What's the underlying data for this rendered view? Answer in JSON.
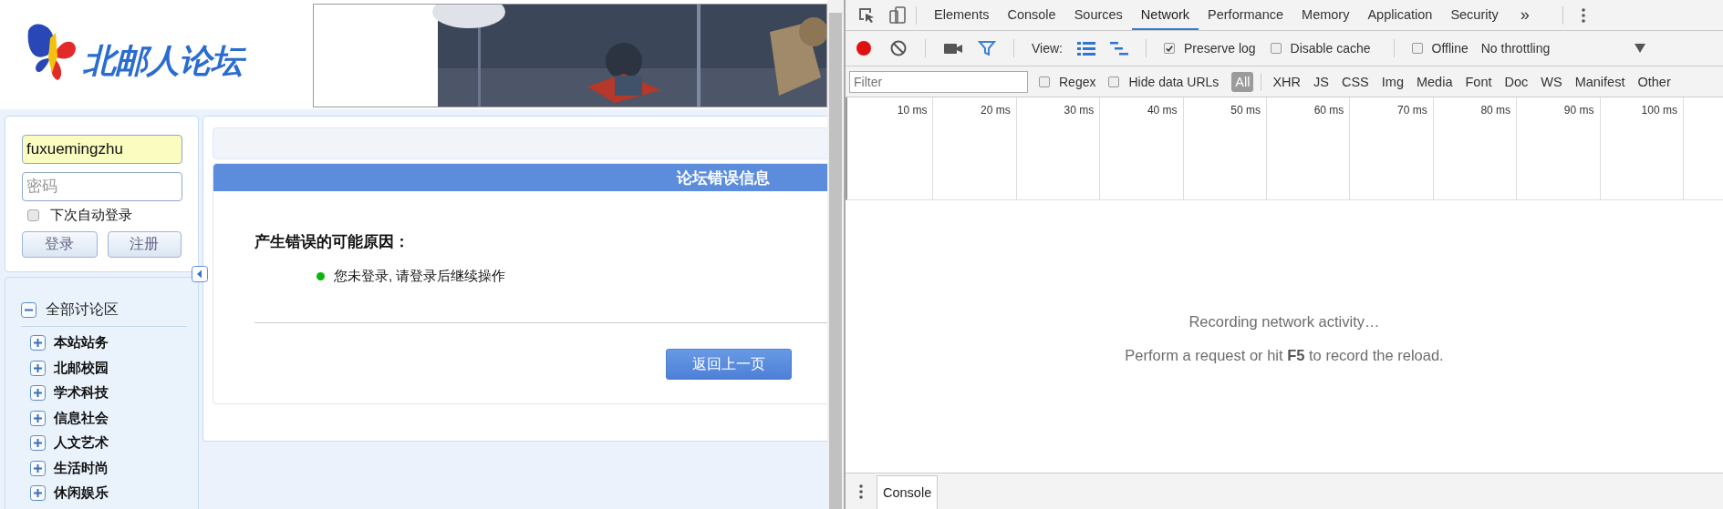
{
  "forum": {
    "logo_text": "北邮人论坛",
    "login": {
      "username": "fuxuemingzhu",
      "password_placeholder": "密码",
      "remember": {
        "label": "下次自动登录",
        "checked": false
      },
      "buttons": [
        "登录",
        "注册"
      ]
    },
    "tree": {
      "label": "全部讨论区",
      "expanded": true,
      "children": [
        {
          "label": "本站站务",
          "expanded": false
        },
        {
          "label": "北邮校园",
          "expanded": false
        },
        {
          "label": "学术科技",
          "expanded": false
        },
        {
          "label": "信息社会",
          "expanded": false
        },
        {
          "label": "人文艺术",
          "expanded": false
        },
        {
          "label": "生活时尚",
          "expanded": false
        },
        {
          "label": "休闲娱乐",
          "expanded": false
        }
      ]
    },
    "error": {
      "title": "论坛错误信息",
      "heading": "产生错误的可能原因：",
      "reasons": [
        "您未登录, 请登录后继续操作"
      ],
      "back_button": "返回上一页"
    }
  },
  "devtools": {
    "tabs": [
      {
        "label": "Elements",
        "selected": false
      },
      {
        "label": "Console",
        "selected": false
      },
      {
        "label": "Sources",
        "selected": false
      },
      {
        "label": "Network",
        "selected": true
      },
      {
        "label": "Performance",
        "selected": false
      },
      {
        "label": "Memory",
        "selected": false
      },
      {
        "label": "Application",
        "selected": false
      },
      {
        "label": "Security",
        "selected": false
      }
    ],
    "more": "»",
    "toolbar": {
      "recording": true,
      "filter_on": true,
      "view_label": "View:",
      "view_toggles": [
        {
          "kind": "rows",
          "on": true
        },
        {
          "kind": "overview",
          "on": true
        }
      ],
      "checks": [
        {
          "label": "Preserve log",
          "checked": true
        },
        {
          "label": "Disable cache",
          "checked": false
        }
      ],
      "offline": {
        "label": "Offline",
        "checked": false
      },
      "throttling": "No throttling"
    },
    "filter": {
      "placeholder": "Filter",
      "options": [
        {
          "label": "Regex",
          "checked": false
        },
        {
          "label": "Hide data URLs",
          "checked": false
        }
      ],
      "types": [
        {
          "label": "All",
          "selected": true
        },
        {
          "label": "XHR",
          "selected": false
        },
        {
          "label": "JS",
          "selected": false
        },
        {
          "label": "CSS",
          "selected": false
        },
        {
          "label": "Img",
          "selected": false
        },
        {
          "label": "Media",
          "selected": false
        },
        {
          "label": "Font",
          "selected": false
        },
        {
          "label": "Doc",
          "selected": false
        },
        {
          "label": "WS",
          "selected": false
        },
        {
          "label": "Manifest",
          "selected": false
        },
        {
          "label": "Other",
          "selected": false
        }
      ]
    },
    "timeline": {
      "ticks": [
        "10 ms",
        "20 ms",
        "30 ms",
        "40 ms",
        "50 ms",
        "60 ms",
        "70 ms",
        "80 ms",
        "90 ms",
        "100 ms"
      ]
    },
    "empty": {
      "title": "Recording network activity…",
      "hint": "Perform a request or hit **F5** to record the reload."
    },
    "drawer": {
      "tabs": [
        "Console"
      ]
    }
  }
}
